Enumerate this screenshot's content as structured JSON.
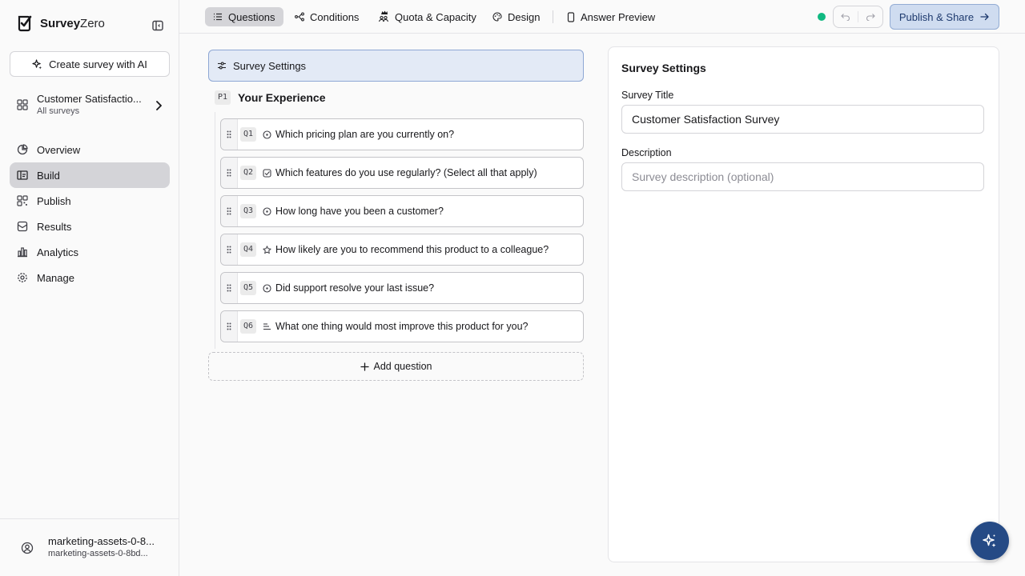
{
  "brand": {
    "name_bold": "Survey",
    "name_light": "Zero"
  },
  "sidebar": {
    "ai_button": "Create survey with AI",
    "survey_selector": {
      "title": "Customer Satisfactio...",
      "subtitle": "All surveys"
    },
    "nav": [
      {
        "label": "Overview",
        "icon": "pie-chart-icon"
      },
      {
        "label": "Build",
        "icon": "build-icon",
        "active": true
      },
      {
        "label": "Publish",
        "icon": "qr-code-icon"
      },
      {
        "label": "Results",
        "icon": "mail-icon"
      },
      {
        "label": "Analytics",
        "icon": "bar-chart-icon"
      },
      {
        "label": "Manage",
        "icon": "gear-icon"
      }
    ],
    "user": {
      "name": "marketing-assets-0-8...",
      "email": "marketing-assets-0-8bd..."
    }
  },
  "topbar": {
    "tabs": [
      {
        "label": "Questions",
        "icon": "list-icon",
        "active": true
      },
      {
        "label": "Conditions",
        "icon": "branch-icon"
      },
      {
        "label": "Quota & Capacity",
        "icon": "users-crown-icon"
      },
      {
        "label": "Design",
        "icon": "palette-icon"
      },
      {
        "label": "Answer Preview",
        "icon": "phone-icon"
      }
    ],
    "publish_label": "Publish & Share"
  },
  "builder": {
    "settings_label": "Survey Settings",
    "page": {
      "badge": "P1",
      "title": "Your Experience"
    },
    "questions": [
      {
        "badge": "Q1",
        "type_icon": "radio-icon",
        "text": "Which pricing plan are you currently on?"
      },
      {
        "badge": "Q2",
        "type_icon": "checkbox-icon",
        "text": "Which features do you use regularly? (Select all that apply)"
      },
      {
        "badge": "Q3",
        "type_icon": "radio-icon",
        "text": "How long have you been a customer?"
      },
      {
        "badge": "Q4",
        "type_icon": "star-icon",
        "text": "How likely are you to recommend this product to a colleague?"
      },
      {
        "badge": "Q5",
        "type_icon": "radio-icon",
        "text": "Did support resolve your last issue?"
      },
      {
        "badge": "Q6",
        "type_icon": "text-lines-icon",
        "text": "What one thing would most improve this product for you?"
      }
    ],
    "add_question": "Add question"
  },
  "panel": {
    "title": "Survey Settings",
    "survey_title_label": "Survey Title",
    "survey_title_value": "Customer Satisfaction Survey",
    "description_label": "Description",
    "description_placeholder": "Survey description (optional)"
  },
  "colors": {
    "accent": "#254a85",
    "status": "#10b981",
    "selected_bg": "#e3eaf6"
  }
}
